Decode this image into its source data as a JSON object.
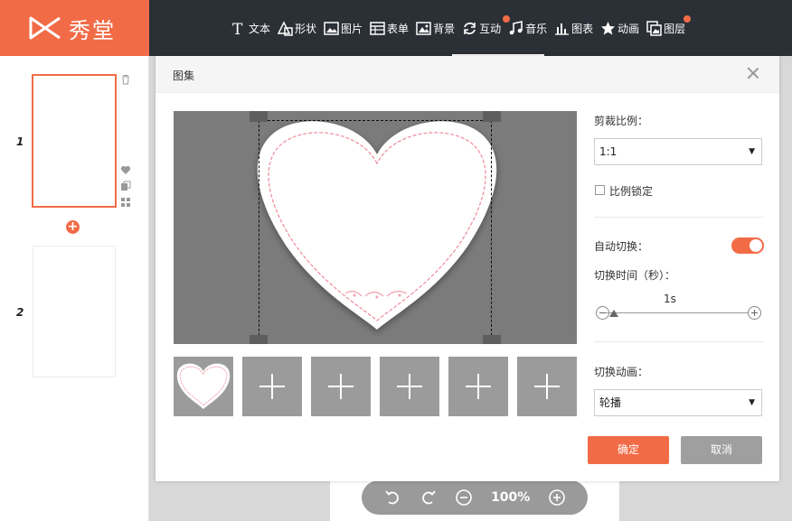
{
  "app": {
    "logo_text": "秀堂"
  },
  "toolbar": {
    "items": [
      {
        "label": "文本",
        "icon": "text-icon"
      },
      {
        "label": "形状",
        "icon": "shape-icon"
      },
      {
        "label": "图片",
        "icon": "image-icon"
      },
      {
        "label": "表单",
        "icon": "form-icon"
      },
      {
        "label": "背景",
        "icon": "background-icon"
      },
      {
        "label": "互动",
        "icon": "interaction-icon"
      },
      {
        "label": "音乐",
        "icon": "music-icon"
      },
      {
        "label": "图表",
        "icon": "chart-icon"
      },
      {
        "label": "动画",
        "icon": "animation-star-icon"
      },
      {
        "label": "图层",
        "icon": "layer-icon"
      }
    ]
  },
  "sidebar": {
    "pages": [
      {
        "number": "1"
      },
      {
        "number": "2"
      }
    ]
  },
  "dialog": {
    "title": "图集",
    "crop_ratio_label": "剪裁比例：",
    "crop_ratio_value": "1:1",
    "lock_ratio_label": "比例锁定",
    "auto_switch_label": "自动切换：",
    "switch_time_label": "切换时间（秒）：",
    "switch_time_value": "1s",
    "switch_anim_label": "切换动画：",
    "switch_anim_value": "轮播",
    "confirm_label": "确定",
    "cancel_label": "取消"
  },
  "zoom": {
    "value": "100%"
  },
  "colors": {
    "accent": "#f26b47",
    "topbar": "#2b2f36"
  }
}
